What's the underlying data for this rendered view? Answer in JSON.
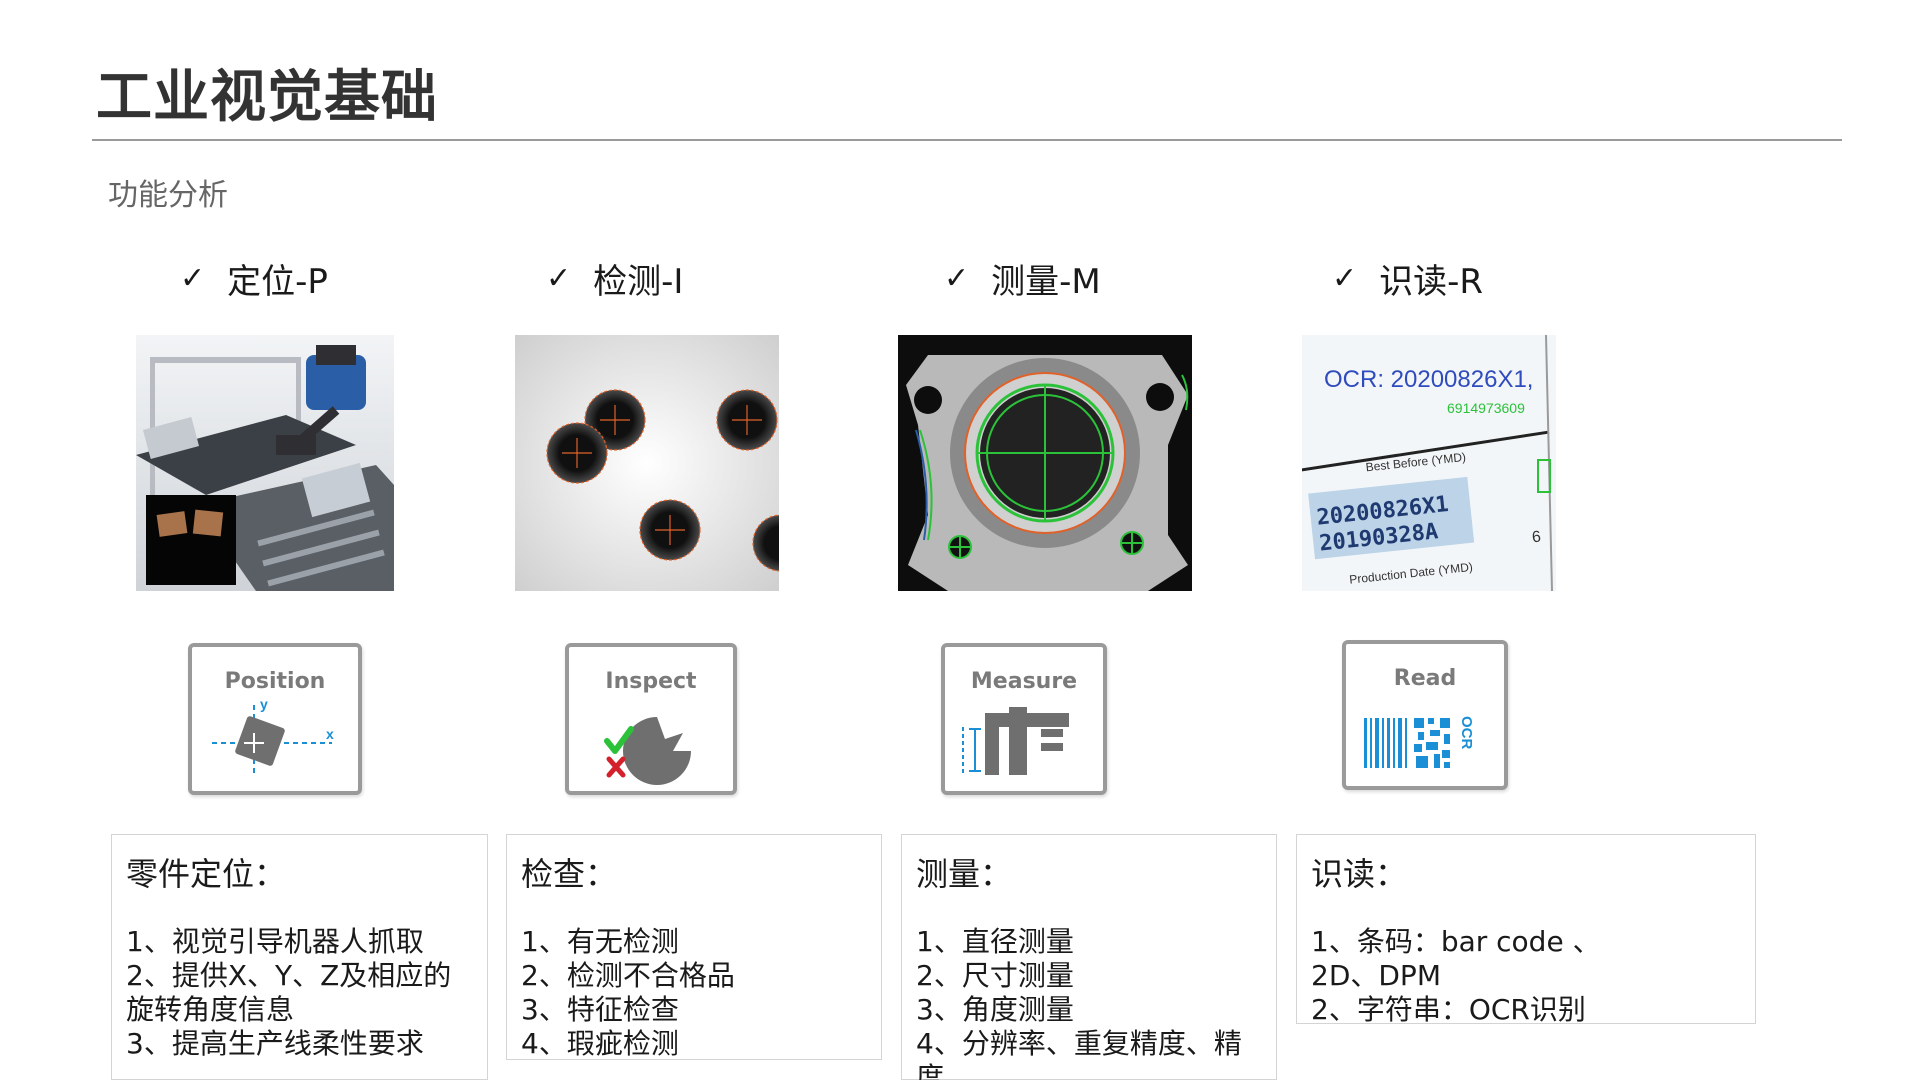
{
  "page": {
    "title": "工业视觉基础",
    "subtitle": "功能分析"
  },
  "columns": [
    {
      "check": "✓",
      "heading": "定位-P",
      "icon_label": "Position",
      "icon_axis_y": "y",
      "icon_axis_x": "x",
      "desc_title": "零件定位：",
      "desc_lines": [
        "1、视觉引导机器人抓取",
        "2、提供X、Y、Z及相应的",
        "旋转角度信息",
        "3、提高生产线柔性要求"
      ]
    },
    {
      "check": "✓",
      "heading": "检测-I",
      "icon_label": "Inspect",
      "desc_title": "检查：",
      "desc_lines": [
        "1、有无检测",
        "2、检测不合格品",
        "3、特征检查",
        "4、瑕疵检测"
      ]
    },
    {
      "check": "✓",
      "heading": "测量-M",
      "icon_label": "Measure",
      "desc_title": "测量：",
      "desc_lines": [
        "1、直径测量",
        "2、尺寸测量",
        "3、角度测量",
        "4、分辨率、重复精度、精",
        "度"
      ]
    },
    {
      "check": "✓",
      "heading": "识读-R",
      "icon_label": "Read",
      "icon_side_text": "OCR",
      "photo_texts": [
        "OCR:  20200826X1,",
        "6914973609",
        "Best Before (YMD)",
        "20200826X1",
        "20190328A",
        "Production Date (YMD)",
        "6"
      ],
      "desc_title": "识读：",
      "desc_lines": [
        "1、条码：bar code 、",
        "2D、DPM",
        "2、字符串：OCR识别"
      ]
    }
  ],
  "colors": {
    "accent_green": "#2bc23a",
    "accent_orange": "#e0622a",
    "ocr_blue": "#2f4bbd",
    "icon_blue": "#1a8fd6",
    "icon_gray": "#6f6f6f",
    "check_red": "#d4202a"
  }
}
